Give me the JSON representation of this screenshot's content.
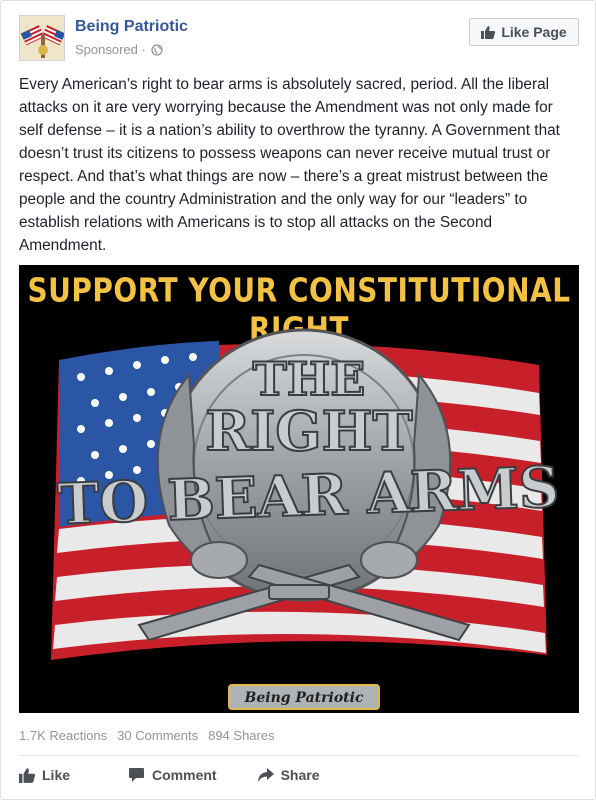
{
  "post": {
    "page_name": "Being Patriotic",
    "sponsored": "Sponsored ·",
    "like_page_label": "Like Page",
    "text": "Every American’s right to bear arms is absolutely sacred, period. All the liberal attacks on it are very worrying because the Amendment was not only made for self defense – it is a nation’s ability to overthrow the tyranny. A Government that doesn’t trust its citizens to possess weapons can never receive mutual trust or respect. And that’s what things are now – there’s a great mistrust between the people and the country Administration and the only way for our “leaders” to establish relations with Americans is to stop all attacks on the Second Amendment.",
    "image": {
      "banner": "SUPPORT YOUR CONSTITUTIONAL RIGHT",
      "buckle_line1": "THE",
      "buckle_line2": "RIGHT",
      "buckle_line3": "TO BEAR ARMS",
      "plaque": "Being Patriotic"
    },
    "reactions": "1.7K Reactions",
    "comments": "30 Comments",
    "shares": "894 Shares"
  },
  "actions": {
    "like": "Like",
    "comment": "Comment",
    "share": "Share"
  },
  "colors": {
    "link": "#365899",
    "banner_gold": "#f4c243",
    "flag_red": "#c8202b",
    "flag_blue": "#2b56a6"
  },
  "icons": [
    "globe-icon",
    "thumbs-up-icon",
    "comment-icon",
    "share-icon"
  ]
}
